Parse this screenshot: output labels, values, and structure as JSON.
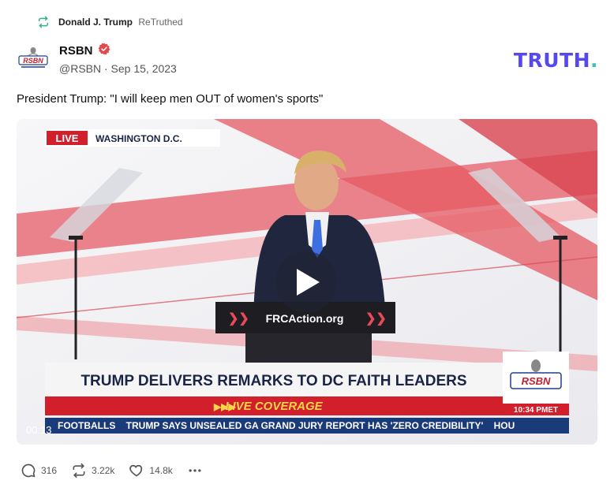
{
  "retruth": {
    "icon": "retruth-icon",
    "user": "Donald J. Trump",
    "action": "ReTruthed"
  },
  "author": {
    "avatar_text": "RSBN",
    "name": "RSBN",
    "verified_icon": "verified-badge-icon",
    "handle_date": "@RSBN · Sep 15, 2023"
  },
  "brand": {
    "logo_text": "TRUTH",
    "logo_dot": ".",
    "accent": "#5448ee",
    "dot_color": "#33c6b4"
  },
  "post": {
    "text": "President Trump: \"I will keep men OUT of women's sports\""
  },
  "video": {
    "live_tag": "LIVE",
    "location": "WASHINGTON D.C.",
    "podium_text": "FRCAction.org",
    "headline": "TRUMP DELIVERS REMARKS TO DC FAITH LEADERS",
    "subheadline": "LIVE COVERAGE",
    "ticker": "FOOTBALLS    TRUMP SAYS UNSEALED GA GRAND JURY REPORT HAS 'ZERO CREDIBILITY'    HOU",
    "network": "RSBN",
    "clock": "10:34 PMET",
    "timestamp": "00:13",
    "play_icon": "play-icon"
  },
  "actions": {
    "replies": "316",
    "retruths": "3.22k",
    "likes": "14.8k",
    "more_icon": "more-icon"
  }
}
